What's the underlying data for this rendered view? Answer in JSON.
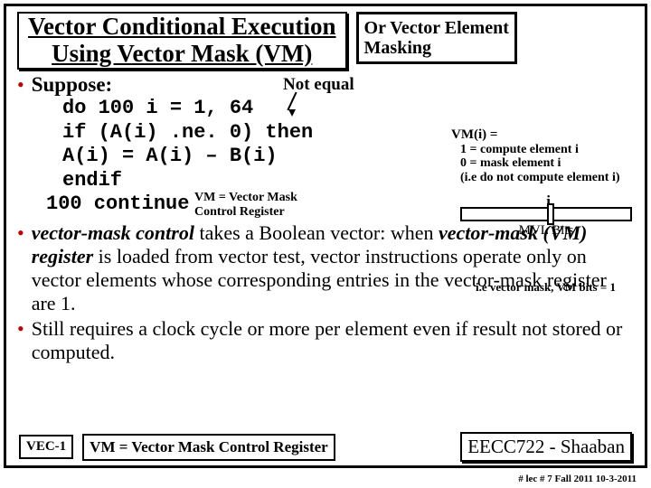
{
  "header": {
    "title_line1": "Vector Conditional Execution",
    "title_line2": "Using Vector Mask (VM)",
    "alt_line1": "Or Vector Element",
    "alt_line2": "Masking"
  },
  "suppose": {
    "label": "Suppose:",
    "not_equal": "Not equal"
  },
  "code": {
    "l1": "do 100 i = 1, 64",
    "l2": "   if (A(i) .ne. 0) then",
    "l3": "         A(i) = A(i) – B(i)",
    "l4": "   endif",
    "l5": "100 continue"
  },
  "vm_caption": {
    "l1": "VM = Vector Mask",
    "l2": "Control Register"
  },
  "vm_side": {
    "hdr": "VM(i) =",
    "s1": "1 = compute element i",
    "s2": "0 = mask element i",
    "s3": "(i.e do not compute element i)"
  },
  "reg": {
    "i": "i",
    "label": "MVL Bits"
  },
  "bullets": {
    "b1_pre": "vector-mask control ",
    "b1_mid": "takes a Boolean vector: when ",
    "b1_em": "vector-mask (VM) register ",
    "b1_rest": "is loaded from vector test, vector instructions operate only on vector elements whose corresponding entries in the vector-mask register are 1.",
    "b1_tiny": "i.e vector mask, VM bits = 1",
    "b2": "Still requires a clock cycle or more per element even if result not stored or computed."
  },
  "footer": {
    "vec": "VEC-1",
    "vm": "VM = Vector Mask Control Register",
    "course": "EECC722 - Shaaban",
    "page": "#  lec # 7    Fall 2011   10-3-2011"
  }
}
